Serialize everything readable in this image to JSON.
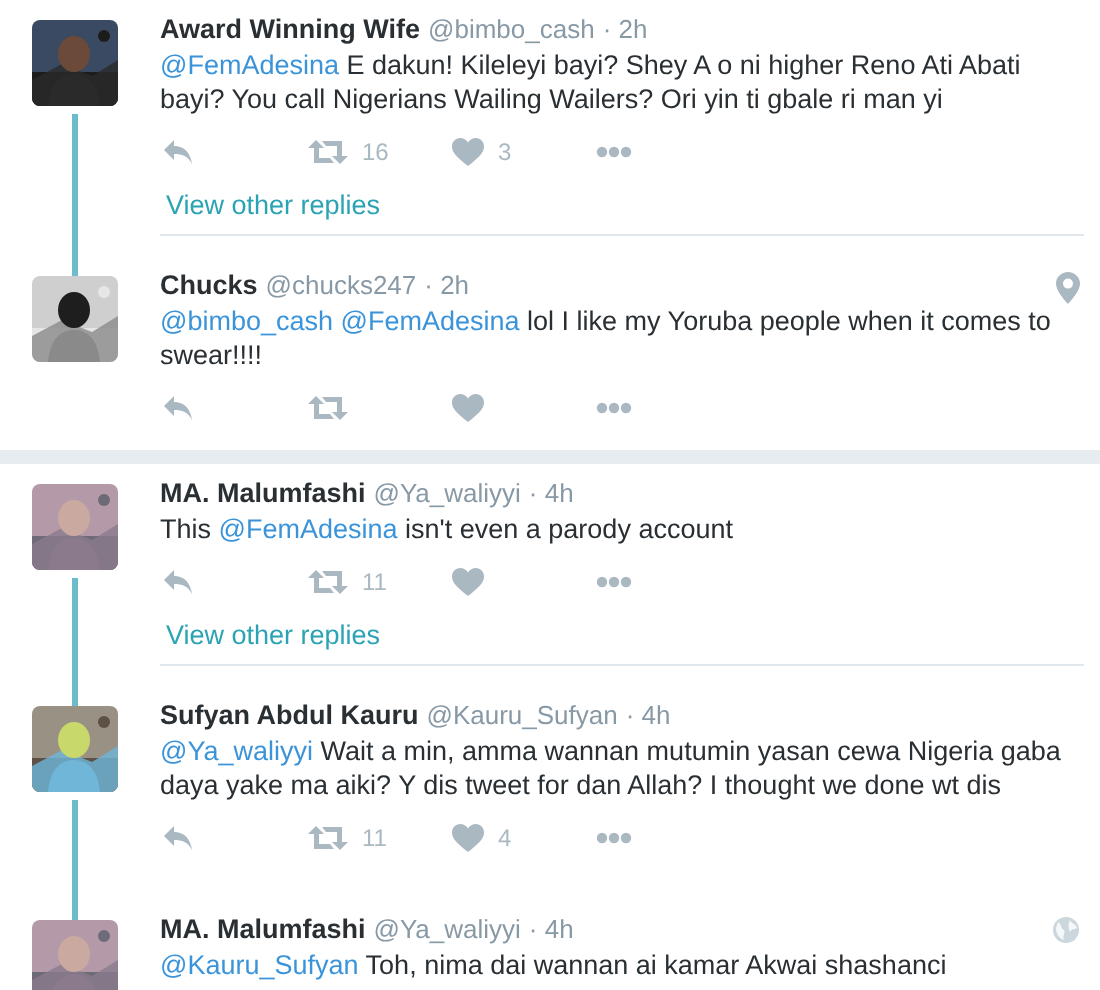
{
  "threads": [
    {
      "tweets": [
        {
          "name": "Award Winning Wife",
          "handle": "@bimbo_cash",
          "time": "· 2h",
          "thread_line": true,
          "text": [
            {
              "kind": "mention",
              "s": "@FemAdesina"
            },
            {
              "kind": "text",
              "s": "E dakun! Kileleyi bayi? Shey A o ni higher Reno Ati Abati bayi? You call Nigerians Wailing Wailers? Ori yin ti gbale ri man yi"
            }
          ],
          "retweets": "16",
          "likes": "3",
          "more_link": "View other replies"
        },
        {
          "name": "Chucks",
          "handle": "@chucks247",
          "time": "· 2h",
          "thread_line": false,
          "corner_icon": {
            "kind": "location"
          },
          "text": [
            {
              "kind": "mention",
              "s": "@bimbo_cash"
            },
            {
              "kind": "mention",
              "s": "@FemAdesina"
            },
            {
              "kind": "text",
              "s": "lol I like my Yoruba people when it comes to swear!!!!"
            }
          ]
        }
      ]
    },
    {
      "tweets": [
        {
          "name": "MA. Malumfashi",
          "handle": "@Ya_waliyyi",
          "time": "· 4h",
          "thread_line": true,
          "text": [
            {
              "kind": "text",
              "s": "This"
            },
            {
              "kind": "mention",
              "s": "@FemAdesina"
            },
            {
              "kind": "text",
              "s": "isn't even a parody account"
            }
          ],
          "retweets": "11",
          "more_link": "View other replies"
        },
        {
          "name": "Sufyan Abdul Kauru",
          "handle": "@Kauru_Sufyan",
          "time": "· 4h",
          "thread_line": true,
          "text": [
            {
              "kind": "mention",
              "s": "@Ya_waliyyi"
            },
            {
              "kind": "text",
              "s": "Wait a min, amma wannan mutumin yasan cewa Nigeria gaba daya yake ma aiki? Y dis tweet for dan Allah? I thought we done wt dis"
            }
          ],
          "retweets": "11",
          "likes": "4"
        },
        {
          "name": "MA. Malumfashi",
          "handle": "@Ya_waliyyi",
          "time": "· 4h",
          "thread_line": false,
          "corner_icon": {
            "kind": "globe"
          },
          "text": [
            {
              "kind": "mention",
              "s": "@Kauru_Sufyan"
            },
            {
              "kind": "text",
              "s": "Toh, nima dai wannan ai kamar Akwai shashanci"
            }
          ]
        }
      ]
    }
  ]
}
